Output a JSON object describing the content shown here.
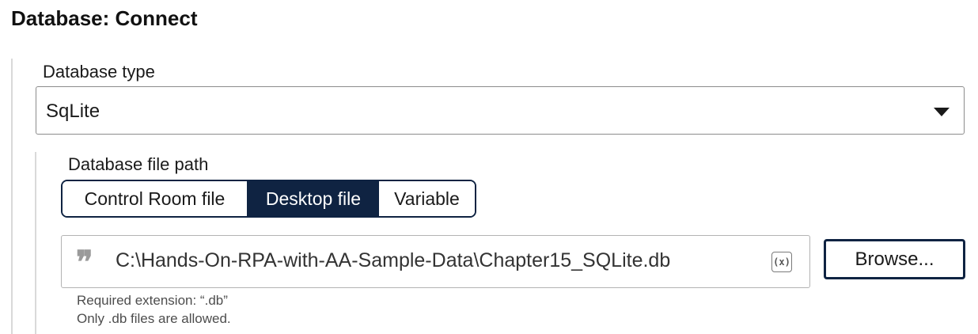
{
  "header": {
    "title": "Database: Connect"
  },
  "database_type": {
    "label": "Database type",
    "selected": "SqLite"
  },
  "file_path": {
    "label": "Database file path",
    "tabs": [
      "Control Room file",
      "Desktop file",
      "Variable"
    ],
    "active_tab": "Desktop file",
    "value": "C:\\Hands-On-RPA-with-AA-Sample-Data\\Chapter15_SQLite.db",
    "variable_icon_text": "(x)",
    "browse_label": "Browse...",
    "hint_extension": "Required extension: “.db”",
    "hint_allowed": "Only .db files are allowed."
  },
  "icons": {
    "select_caret": "caret-down-icon",
    "string_marker": "quote-icon",
    "variable_insert": "variable-icon"
  },
  "colors": {
    "accent_navy": "#0f2342",
    "rail_gray": "#d9d9d9",
    "hint_text": "#4d4d4d"
  }
}
